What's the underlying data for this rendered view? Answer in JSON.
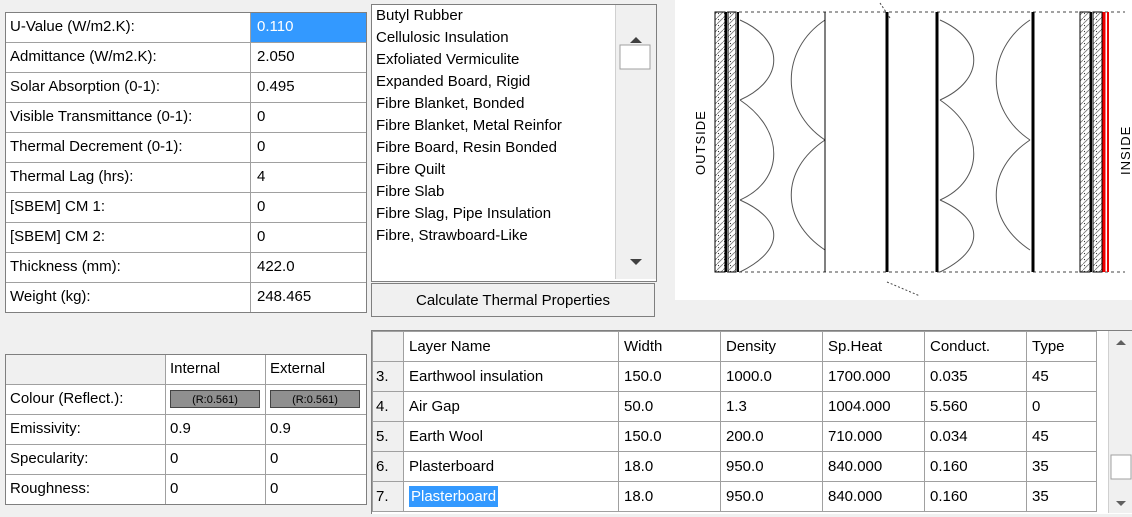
{
  "properties": [
    {
      "label": "U-Value (W/m2.K):",
      "value": "0.110",
      "selected": true
    },
    {
      "label": "Admittance (W/m2.K):",
      "value": "2.050"
    },
    {
      "label": "Solar Absorption (0-1):",
      "value": "0.495"
    },
    {
      "label": "Visible Transmittance (0-1):",
      "value": "0"
    },
    {
      "label": "Thermal Decrement (0-1):",
      "value": "0"
    },
    {
      "label": "Thermal Lag (hrs):",
      "value": "4"
    },
    {
      "label": "[SBEM] CM 1:",
      "value": "0"
    },
    {
      "label": "[SBEM] CM 2:",
      "value": "0"
    },
    {
      "label": "Thickness (mm):",
      "value": "422.0"
    },
    {
      "label": "Weight (kg):",
      "value": "248.465"
    }
  ],
  "surface": {
    "headers": [
      "",
      "Internal",
      "External"
    ],
    "rows": [
      {
        "label": "Colour (Reflect.):",
        "internal": "(R:0.561)",
        "external": "(R:0.561)",
        "swatch": true
      },
      {
        "label": "Emissivity:",
        "internal": "0.9",
        "external": "0.9"
      },
      {
        "label": "Specularity:",
        "internal": "0",
        "external": "0"
      },
      {
        "label": "Roughness:",
        "internal": "0",
        "external": "0"
      }
    ]
  },
  "materials": [
    "Butyl Rubber",
    "Cellulosic Insulation",
    "Exfoliated Vermiculite",
    "Expanded Board, Rigid",
    "Fibre Blanket, Bonded",
    "Fibre Blanket, Metal Reinfor",
    "Fibre Board, Resin Bonded",
    "Fibre Quilt",
    "Fibre Slab",
    "Fibre Slag, Pipe Insulation",
    "Fibre, Strawboard-Like"
  ],
  "calc_button": "Calculate Thermal Properties",
  "layers": {
    "headers": [
      "Layer Name",
      "Width",
      "Density",
      "Sp.Heat",
      "Conduct.",
      "Type"
    ],
    "rows": [
      {
        "num": "3.",
        "name": "Earthwool insulation",
        "width": "150.0",
        "density": "1000.0",
        "spheat": "1700.000",
        "conduct": "0.035",
        "type": "45"
      },
      {
        "num": "4.",
        "name": "Air Gap",
        "width": "50.0",
        "density": "1.3",
        "spheat": "1004.000",
        "conduct": "5.560",
        "type": "0"
      },
      {
        "num": "5.",
        "name": "Earth Wool",
        "width": "150.0",
        "density": "200.0",
        "spheat": "710.000",
        "conduct": "0.034",
        "type": "45"
      },
      {
        "num": "6.",
        "name": "Plasterboard",
        "width": "18.0",
        "density": "950.0",
        "spheat": "840.000",
        "conduct": "0.160",
        "type": "35"
      },
      {
        "num": "7.",
        "name": "Plasterboard",
        "width": "18.0",
        "density": "950.0",
        "spheat": "840.000",
        "conduct": "0.160",
        "type": "35",
        "selected": true
      }
    ]
  },
  "diagram": {
    "outside_label": "OUTSIDE",
    "inside_label": "INSIDE"
  },
  "icons": {
    "scroll_up": "arrow-up-icon",
    "scroll_down": "arrow-down-icon"
  }
}
